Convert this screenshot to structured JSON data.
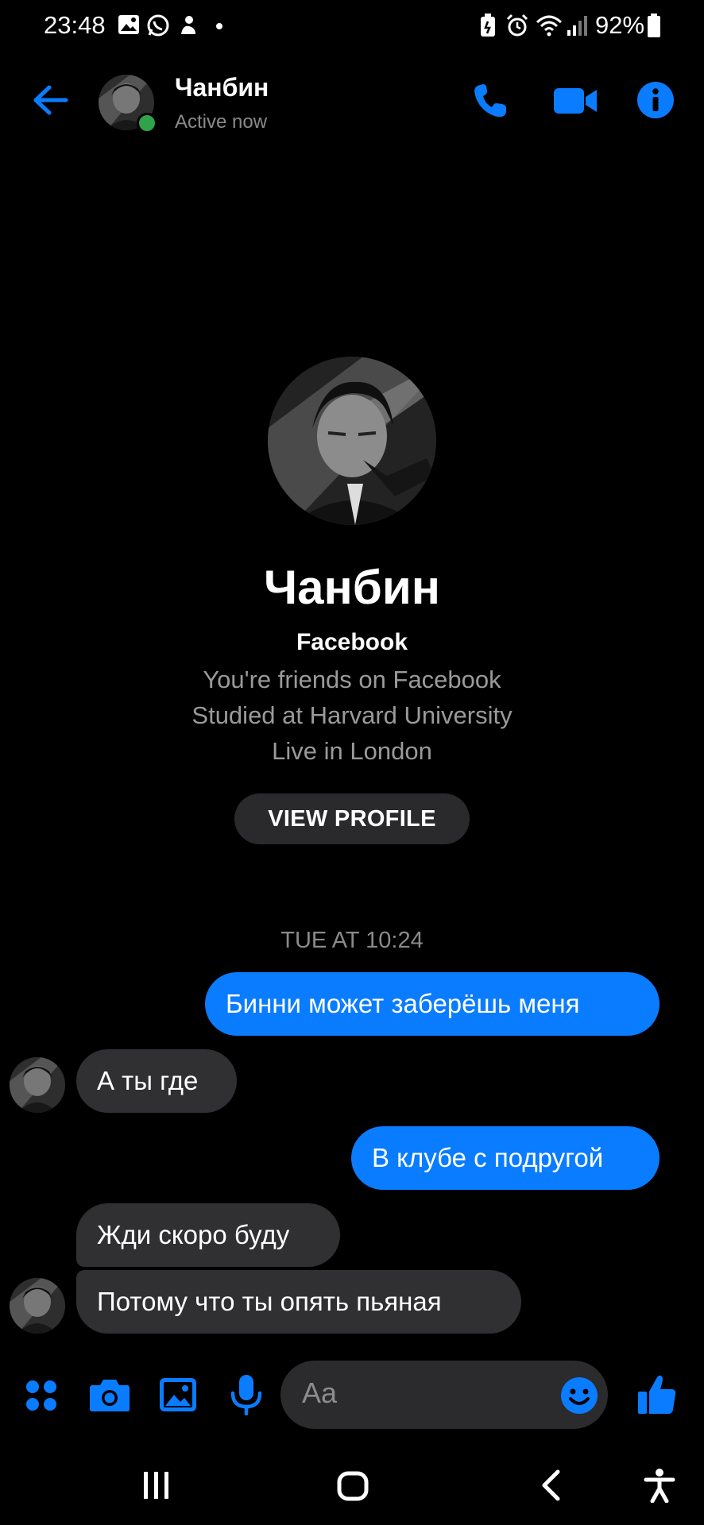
{
  "status_bar": {
    "time": "23:48",
    "battery": "92%"
  },
  "header": {
    "name": "Чанбин",
    "status": "Active now"
  },
  "profile": {
    "name": "Чанбин",
    "platform": "Facebook",
    "lines": [
      "You're friends on Facebook",
      "Studied at Harvard University",
      "Live in London"
    ],
    "view_profile_label": "VIEW PROFILE"
  },
  "conversation": {
    "timestamp": "TUE AT 10:24",
    "messages": [
      {
        "direction": "outgoing",
        "text": "Бинни может заберёшь меня"
      },
      {
        "direction": "incoming",
        "text": "А ты где"
      },
      {
        "direction": "outgoing",
        "text": "В клубе с подругой"
      },
      {
        "direction": "incoming",
        "text": "Жди скоро буду"
      },
      {
        "direction": "incoming",
        "text": "Потому что ты опять пьяная"
      }
    ]
  },
  "composer": {
    "placeholder": "Aa"
  },
  "colors": {
    "accent": "#0a7cff",
    "incoming_bubble": "#303033",
    "background": "#000000",
    "online": "#31a24c"
  },
  "icons": {
    "header": [
      "back-arrow-icon",
      "phone-icon",
      "video-camera-icon",
      "info-icon"
    ],
    "composer": [
      "apps-icon",
      "camera-icon",
      "gallery-icon",
      "microphone-icon",
      "emoji-icon",
      "thumbs-up-icon"
    ],
    "navigation": [
      "recent-apps-icon",
      "home-icon",
      "back-icon",
      "accessibility-icon"
    ]
  }
}
